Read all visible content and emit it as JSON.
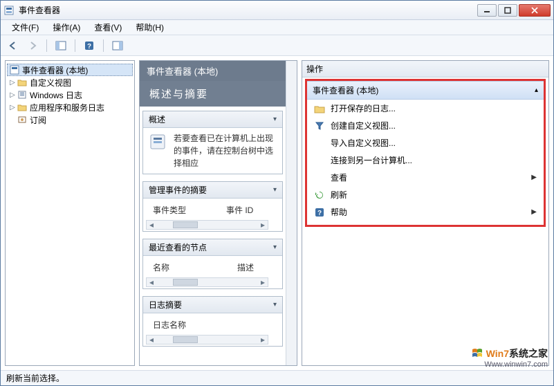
{
  "window": {
    "title": "事件查看器"
  },
  "menu": {
    "file": "文件(F)",
    "action": "操作(A)",
    "view": "查看(V)",
    "help": "帮助(H)"
  },
  "tree": {
    "root": "事件查看器 (本地)",
    "items": [
      {
        "label": "自定义视图",
        "expandable": true
      },
      {
        "label": "Windows 日志",
        "expandable": true
      },
      {
        "label": "应用程序和服务日志",
        "expandable": true
      },
      {
        "label": "订阅",
        "expandable": false
      }
    ]
  },
  "center": {
    "title": "事件查看器 (本地)",
    "subtitle": "概述与摘要",
    "sections": {
      "overview": {
        "head": "概述",
        "desc": "若要查看已在计算机上出现的事件，请在控制台树中选择相应"
      },
      "summary": {
        "head": "管理事件的摘要",
        "cols": [
          "事件类型",
          "事件 ID"
        ]
      },
      "recent": {
        "head": "最近查看的节点",
        "cols": [
          "名称",
          "描述"
        ]
      },
      "log": {
        "head": "日志摘要",
        "cols": [
          "日志名称"
        ]
      }
    }
  },
  "actions": {
    "pane_title": "操作",
    "group_title": "事件查看器 (本地)",
    "items": [
      {
        "key": "open-saved",
        "label": "打开保存的日志...",
        "icon": "folder",
        "arrow": false
      },
      {
        "key": "create-view",
        "label": "创建自定义视图...",
        "icon": "filter",
        "arrow": false
      },
      {
        "key": "import-view",
        "label": "导入自定义视图...",
        "icon": "",
        "arrow": false
      },
      {
        "key": "connect",
        "label": "连接到另一台计算机...",
        "icon": "",
        "arrow": false
      },
      {
        "key": "view",
        "label": "查看",
        "icon": "",
        "arrow": true
      },
      {
        "key": "refresh",
        "label": "刷新",
        "icon": "refresh",
        "arrow": false
      },
      {
        "key": "help",
        "label": "帮助",
        "icon": "help",
        "arrow": true
      }
    ]
  },
  "status": {
    "text": "刷新当前选择。"
  },
  "watermark": {
    "brand_win": "Win7",
    "brand_rest": "系统之家",
    "url": "Www.winwin7.com"
  }
}
